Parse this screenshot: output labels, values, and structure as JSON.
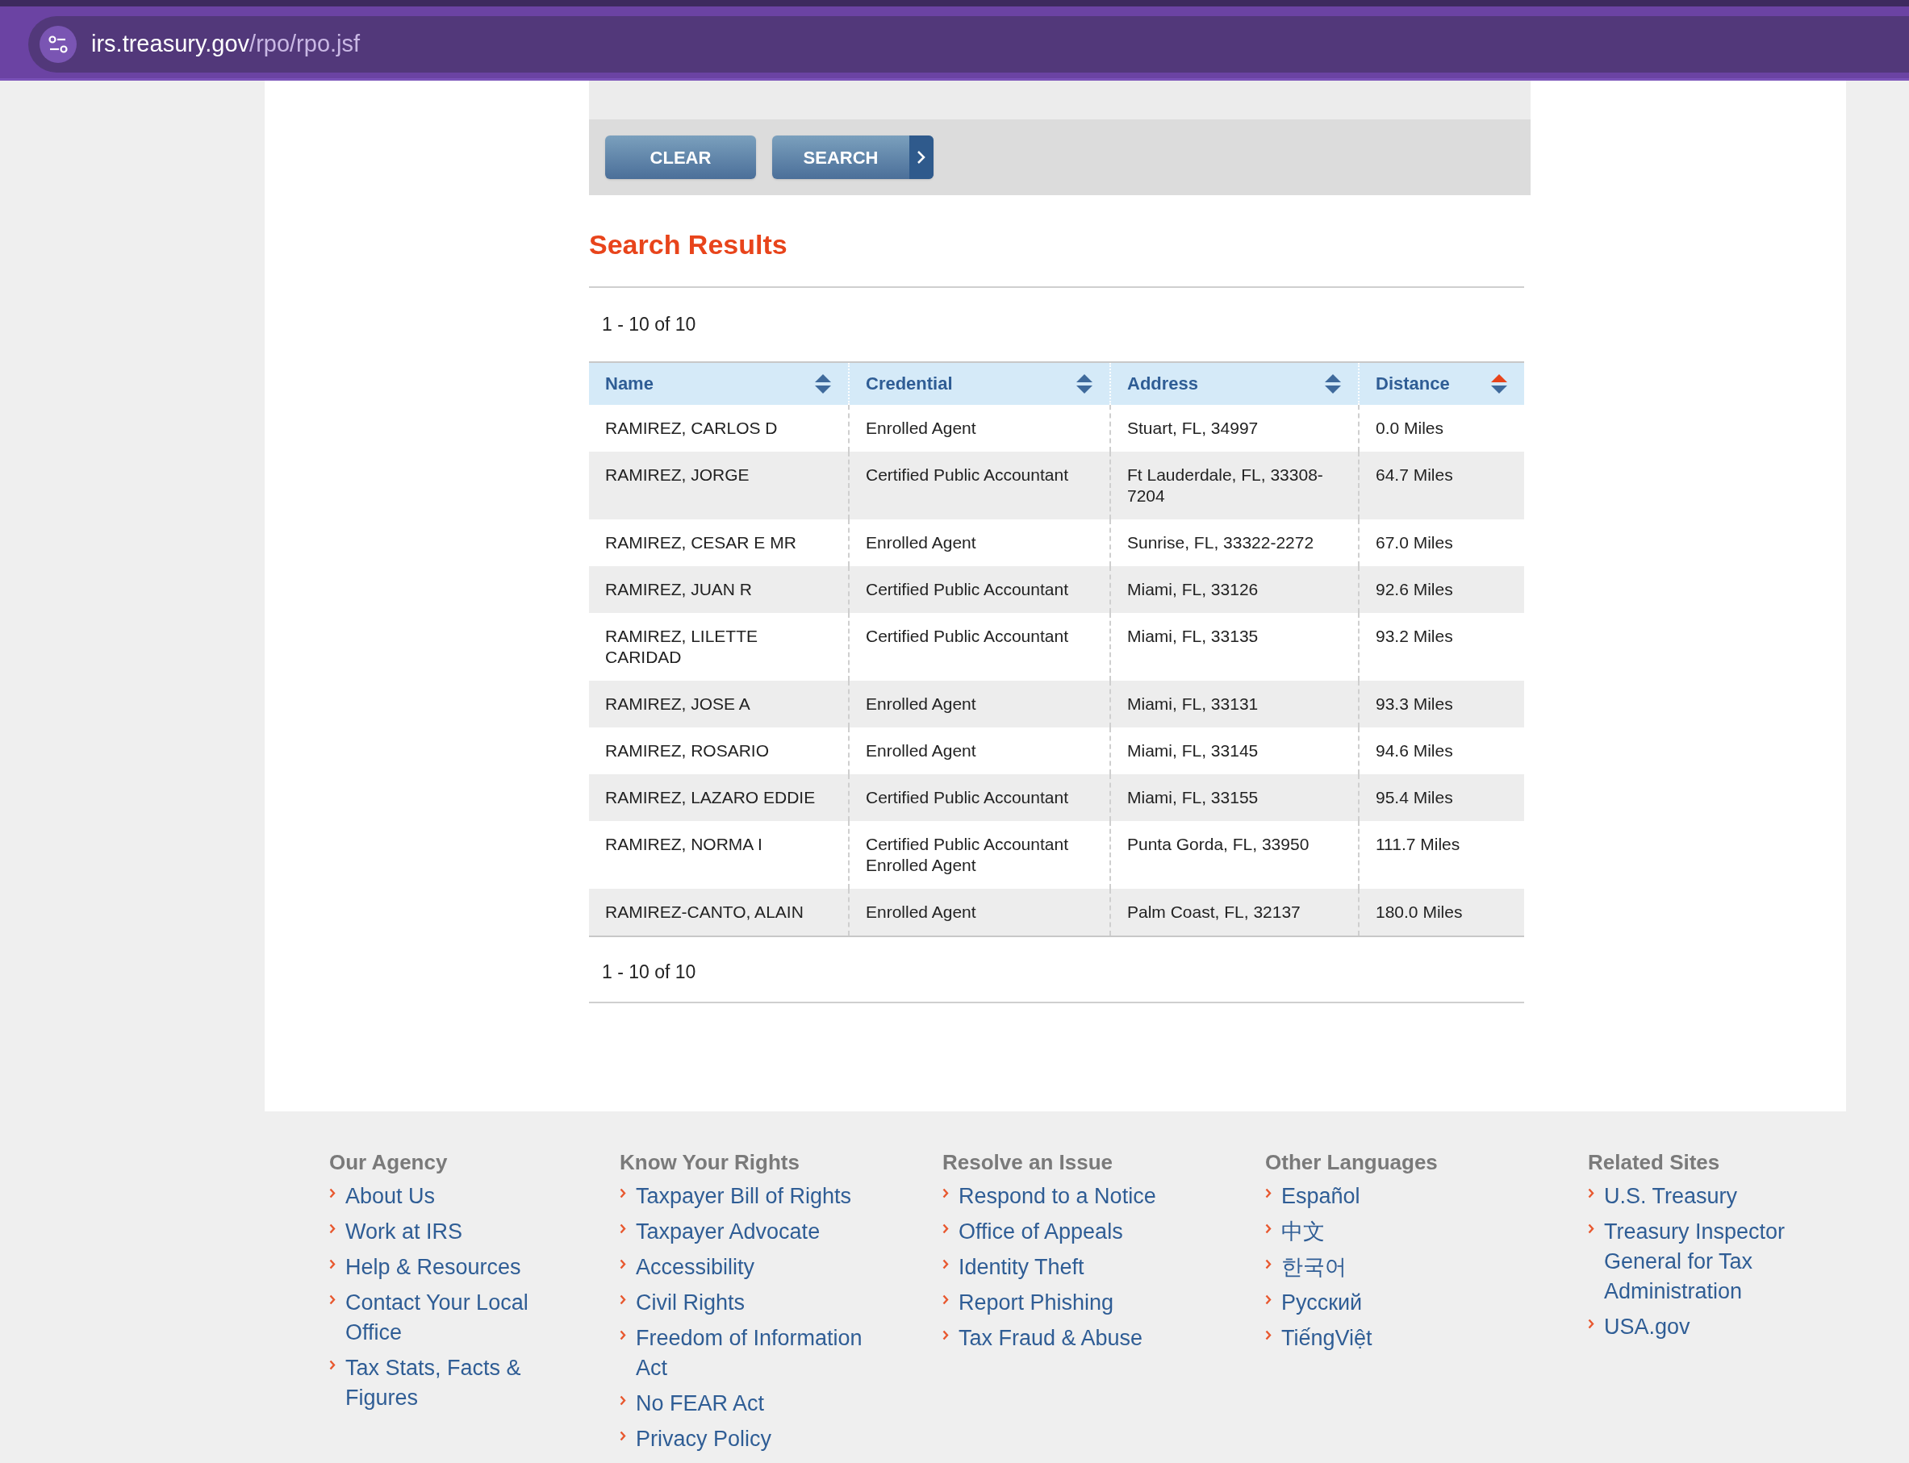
{
  "address_bar": {
    "domain": "irs.treasury.gov",
    "path": "/rpo/rpo.jsf"
  },
  "buttons": [
    {
      "label": "CLEAR",
      "kind": "plain"
    },
    {
      "label": "SEARCH",
      "kind": "arrow"
    }
  ],
  "results_title": "Search Results",
  "range_top": "1 - 10 of 10",
  "table": {
    "columns": [
      {
        "label": "Name",
        "sorted": false
      },
      {
        "label": "Credential",
        "sorted": false
      },
      {
        "label": "Address",
        "sorted": false
      },
      {
        "label": "Distance",
        "sorted": true
      }
    ],
    "rows": [
      {
        "name": "RAMIREZ, CARLOS D",
        "credentials": [
          "Enrolled Agent"
        ],
        "address": "Stuart, FL, 34997",
        "distance": "0.0 Miles"
      },
      {
        "name": "RAMIREZ, JORGE",
        "credentials": [
          "Certified Public Accountant"
        ],
        "address": "Ft Lauderdale, FL, 33308-7204",
        "distance": "64.7 Miles"
      },
      {
        "name": "RAMIREZ, CESAR E MR",
        "credentials": [
          "Enrolled Agent"
        ],
        "address": "Sunrise, FL, 33322-2272",
        "distance": "67.0 Miles"
      },
      {
        "name": "RAMIREZ, JUAN R",
        "credentials": [
          "Certified Public Accountant"
        ],
        "address": "Miami, FL, 33126",
        "distance": "92.6 Miles"
      },
      {
        "name": "RAMIREZ, LILETTE CARIDAD",
        "credentials": [
          "Certified Public Accountant"
        ],
        "address": "Miami, FL, 33135",
        "distance": "93.2 Miles"
      },
      {
        "name": "RAMIREZ, JOSE A",
        "credentials": [
          "Enrolled Agent"
        ],
        "address": "Miami, FL, 33131",
        "distance": "93.3 Miles"
      },
      {
        "name": "RAMIREZ, ROSARIO",
        "credentials": [
          "Enrolled Agent"
        ],
        "address": "Miami, FL, 33145",
        "distance": "94.6 Miles"
      },
      {
        "name": "RAMIREZ, LAZARO EDDIE",
        "credentials": [
          "Certified Public Accountant"
        ],
        "address": "Miami, FL, 33155",
        "distance": "95.4 Miles"
      },
      {
        "name": "RAMIREZ, NORMA I",
        "credentials": [
          "Certified Public Accountant",
          "Enrolled Agent"
        ],
        "address": "Punta Gorda, FL, 33950",
        "distance": "111.7 Miles"
      },
      {
        "name": "RAMIREZ-CANTO, ALAIN",
        "credentials": [
          "Enrolled Agent"
        ],
        "address": "Palm Coast, FL, 32137",
        "distance": "180.0 Miles"
      }
    ]
  },
  "range_bottom": "1 - 10 of 10",
  "footer": [
    {
      "heading": "Our Agency",
      "links": [
        "About Us",
        "Work at IRS",
        "Help & Resources",
        "Contact Your Local Office",
        "Tax Stats, Facts & Figures"
      ]
    },
    {
      "heading": "Know Your Rights",
      "links": [
        "Taxpayer Bill of Rights",
        "Taxpayer Advocate",
        "Accessibility",
        "Civil Rights",
        "Freedom of Information Act",
        "No FEAR Act",
        "Privacy Policy"
      ]
    },
    {
      "heading": "Resolve an Issue",
      "links": [
        "Respond to a Notice",
        "Office of Appeals",
        "Identity Theft",
        "Report Phishing",
        "Tax Fraud & Abuse"
      ]
    },
    {
      "heading": "Other Languages",
      "links": [
        "Español",
        "中文",
        "한국어",
        "Русский",
        "TiếngViệt"
      ]
    },
    {
      "heading": "Related Sites",
      "links": [
        "U.S. Treasury",
        "Treasury Inspector General for Tax Administration",
        "USA.gov"
      ]
    }
  ]
}
